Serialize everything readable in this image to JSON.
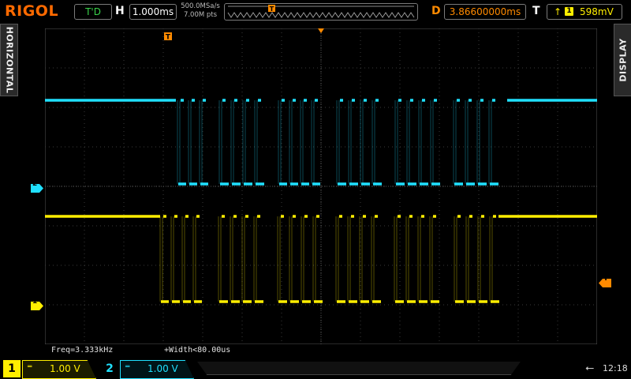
{
  "top": {
    "logo": "RIGOL",
    "trigger_status": "T'D",
    "h_label": "H",
    "timebase": "1.000ms",
    "sample_rate": "500.0MSa/s",
    "mem_depth": "7.00M pts",
    "d_label": "D",
    "delay": "3.86600000ms",
    "t_label": "T",
    "trigger_source": "1",
    "trigger_level": "598mV"
  },
  "side_tabs": {
    "left": "HORIZONTAL",
    "right": "DISPLAY"
  },
  "measurements": {
    "freq": "Freq=3.333kHz",
    "width": "+Width<80.00us"
  },
  "channels": [
    {
      "num": "1",
      "scale": "1.00 V",
      "color": "#ffee00"
    },
    {
      "num": "2",
      "scale": "1.00 V",
      "color": "#20e0ff"
    }
  ],
  "markers": {
    "ch1": "1",
    "ch2": "2",
    "trigger_pos": "T",
    "trigger_level": "T"
  },
  "status": {
    "clock": "12:18"
  },
  "colors": {
    "ch1": "#ffee00",
    "ch2": "#20e0ff",
    "trigger": "#ff8a00",
    "grid": "#3a3a3a"
  }
}
